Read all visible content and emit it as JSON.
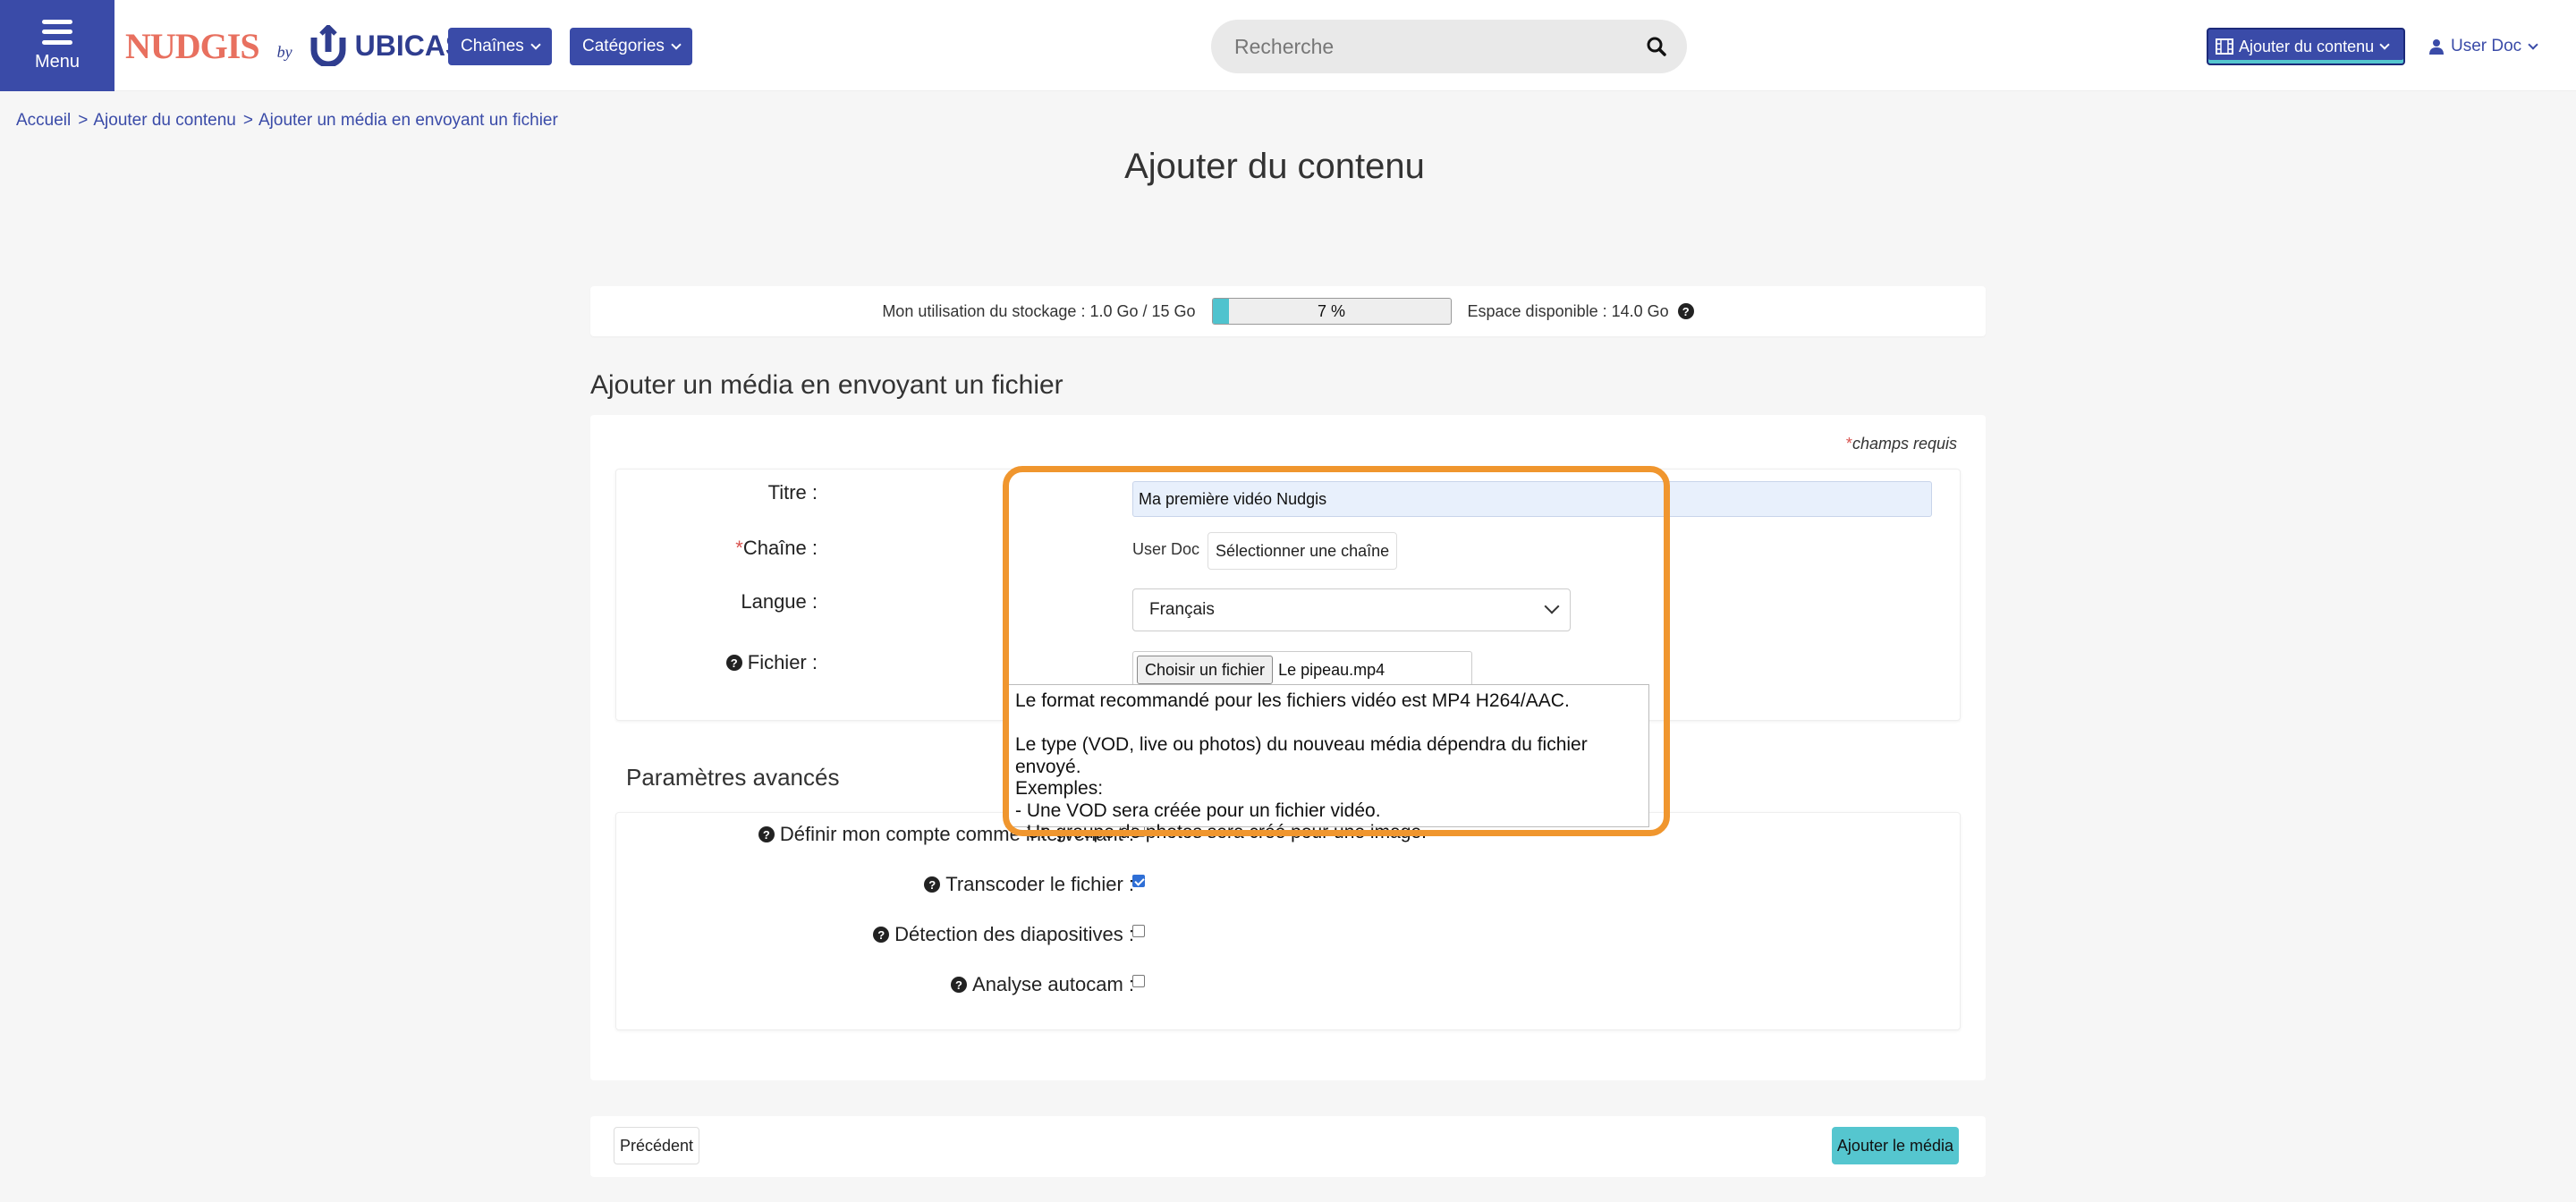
{
  "header": {
    "menu_label": "Menu",
    "logo_brand": "NUDGIS",
    "logo_by": "by",
    "logo_company": "UBICAST",
    "nav_channels": "Chaînes",
    "nav_categories": "Catégories",
    "search_placeholder": "Recherche",
    "add_content": "Ajouter du contenu",
    "user": "User Doc",
    "accent_color": "#3a4ba8",
    "brand_color": "#e8705f"
  },
  "breadcrumb": {
    "items": [
      "Accueil",
      "Ajouter du contenu",
      "Ajouter un média en envoyant un fichier"
    ],
    "separator": ">"
  },
  "page_title": "Ajouter du contenu",
  "storage": {
    "usage_text": "Mon utilisation du stockage : 1.0 Go / 15 Go",
    "percent_label": "7 %",
    "percent_value": 7,
    "available_text": "Espace disponible : 14.0 Go"
  },
  "section_title": "Ajouter un média en envoyant un fichier",
  "form": {
    "required_note": "champs requis",
    "title_label": "Titre :",
    "title_value": "Ma première vidéo Nudgis",
    "channel_label": "Chaîne :",
    "channel_value": "User Doc",
    "channel_button": "Sélectionner une chaîne",
    "language_label": "Langue :",
    "language_value": "Français",
    "file_label": "Fichier :",
    "file_button": "Choisir un fichier",
    "file_name": "Le pipeau.mp4"
  },
  "tooltip": {
    "text": "Le format recommandé pour les fichiers vidéo est MP4 H264/AAC.\n\nLe type (VOD, live ou photos) du nouveau média dépendra du fichier envoyé.\nExemples:\n- Une VOD sera créée pour un fichier vidéo.\n- Un groupe de photos sera créé pour une image."
  },
  "advanced": {
    "title": "Paramètres avancés",
    "options": [
      {
        "label": "Définir mon compte comme intervenant :",
        "checked": false
      },
      {
        "label": "Transcoder le fichier :",
        "checked": true
      },
      {
        "label": "Détection des diapositives :",
        "checked": false
      },
      {
        "label": "Analyse autocam :",
        "checked": false
      }
    ]
  },
  "footer": {
    "previous": "Précédent",
    "submit": "Ajouter le média"
  },
  "highlight_color": "#f0962e"
}
